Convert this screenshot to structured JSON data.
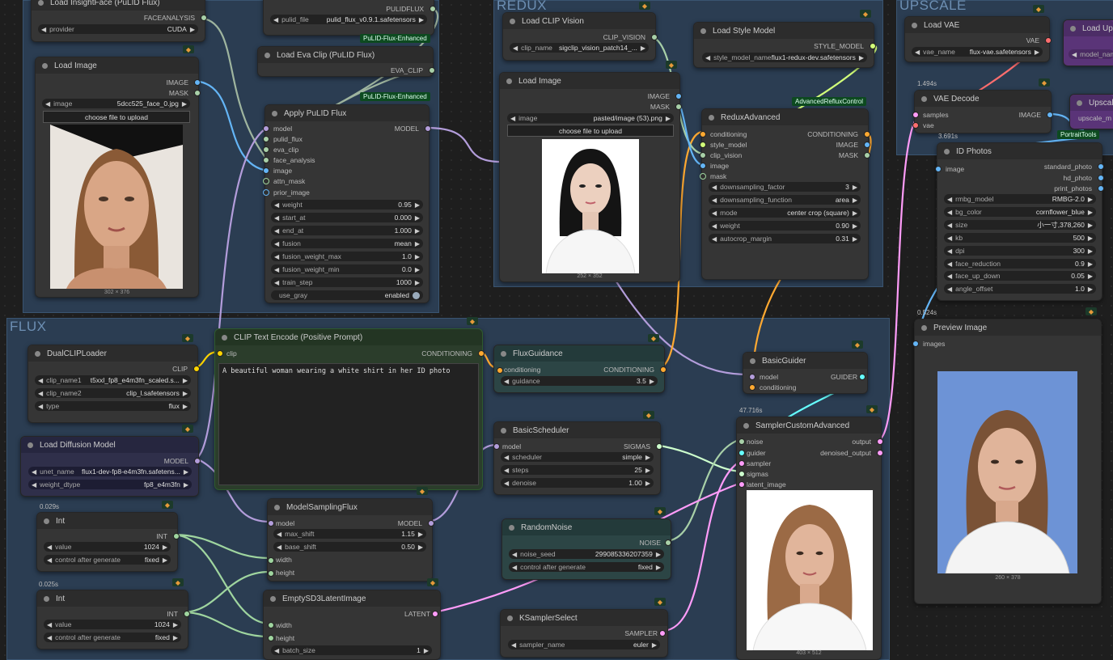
{
  "groups": {
    "flux_title": "FLUX",
    "redux_title": "REDUX",
    "upscale_title": "UPSCALE"
  },
  "nodes": {
    "insightface": {
      "title": "Load InsightFace (PuLID Flux)",
      "out": "FACEANALYSIS",
      "provider_label": "provider",
      "provider_value": "CUDA"
    },
    "pulidmodel": {
      "out": "PULIDFLUX",
      "file_label": "pulid_file",
      "file_value": "pulid_flux_v0.9.1.safetensors",
      "tag": "PuLID-Flux-Enhanced"
    },
    "evaclip": {
      "title": "Load Eva Clip (PuLID Flux)",
      "out": "EVA_CLIP",
      "tag": "PuLID-Flux-Enhanced"
    },
    "loadimage1": {
      "title": "Load Image",
      "out_image": "IMAGE",
      "out_mask": "MASK",
      "image_label": "image",
      "image_value": "5dcc525_face_0.jpg",
      "upload": "choose file to upload",
      "dims": "302 × 376"
    },
    "applypulid": {
      "title": "Apply PuLID Flux",
      "out": "MODEL",
      "inputs": [
        "model",
        "pulid_flux",
        "eva_clip",
        "face_analysis",
        "image",
        "attn_mask",
        "prior_image"
      ],
      "widgets": [
        {
          "label": "weight",
          "value": "0.95"
        },
        {
          "label": "start_at",
          "value": "0.000"
        },
        {
          "label": "end_at",
          "value": "1.000"
        },
        {
          "label": "fusion",
          "value": "mean"
        },
        {
          "label": "fusion_weight_max",
          "value": "1.0"
        },
        {
          "label": "fusion_weight_min",
          "value": "0.0"
        },
        {
          "label": "train_step",
          "value": "1000"
        }
      ],
      "use_gray_label": "use_gray",
      "use_gray_value": "enabled"
    },
    "clipvision": {
      "title": "Load CLIP Vision",
      "out": "CLIP_VISION",
      "name_label": "clip_name",
      "name_value": "sigclip_vision_patch14_..."
    },
    "stylemodel": {
      "title": "Load Style Model",
      "out": "STYLE_MODEL",
      "name_label": "style_model_name",
      "name_value": "flux1-redux-dev.safetensors"
    },
    "loadimage2": {
      "title": "Load Image",
      "out_image": "IMAGE",
      "out_mask": "MASK",
      "image_label": "image",
      "image_value": "pasted/image (53).png",
      "upload": "choose file to upload",
      "dims": "252 × 352"
    },
    "reduxadvanced": {
      "title": "ReduxAdvanced",
      "tag": "AdvancedRefluxControl",
      "inputs": [
        "conditioning",
        "style_model",
        "clip_vision",
        "image",
        "mask"
      ],
      "outputs": [
        "CONDITIONING",
        "IMAGE",
        "MASK"
      ],
      "widgets": [
        {
          "label": "downsampling_factor",
          "value": "3"
        },
        {
          "label": "downsampling_function",
          "value": "area"
        },
        {
          "label": "mode",
          "value": "center crop (square)"
        },
        {
          "label": "weight",
          "value": "0.90"
        },
        {
          "label": "autocrop_margin",
          "value": "0.31"
        }
      ]
    },
    "loadvae": {
      "title": "Load VAE",
      "out": "VAE",
      "name_label": "vae_name",
      "name_value": "flux-vae.safetensors"
    },
    "loadupscale": {
      "title": "Load Upsc",
      "name_label": "model_nam"
    },
    "vaedecode": {
      "title": "VAE Decode",
      "time": "1.494s",
      "in_samples": "samples",
      "in_vae": "vae",
      "out": "IMAGE"
    },
    "upscale2": {
      "title": "Upscale",
      "in": "upscale_m"
    },
    "idphotos": {
      "title": "ID Photos",
      "time": "3.691s",
      "tag": "PortraitTools",
      "in": "image",
      "outputs": [
        "standard_photo",
        "hd_photo",
        "print_photos"
      ],
      "widgets": [
        {
          "label": "rmbg_model",
          "value": "RMBG-2.0"
        },
        {
          "label": "bg_color",
          "value": "cornflower_blue"
        },
        {
          "label": "size",
          "value": "小一寸,378,260"
        },
        {
          "label": "kb",
          "value": "500"
        },
        {
          "label": "dpi",
          "value": "300"
        },
        {
          "label": "face_reduction",
          "value": "0.9"
        },
        {
          "label": "face_up_down",
          "value": "0.05"
        },
        {
          "label": "angle_offset",
          "value": "1.0"
        }
      ]
    },
    "preview": {
      "title": "Preview Image",
      "time": "0.524s",
      "in": "images",
      "dims": "260 × 378"
    },
    "dualclip": {
      "title": "DualCLIPLoader",
      "out": "CLIP",
      "widgets": [
        {
          "label": "clip_name1",
          "value": "t5xxl_fp8_e4m3fn_scaled.s..."
        },
        {
          "label": "clip_name2",
          "value": "clip_l.safetensors"
        },
        {
          "label": "type",
          "value": "flux"
        }
      ]
    },
    "cliptext": {
      "title": "CLIP Text Encode (Positive Prompt)",
      "in": "clip",
      "out": "CONDITIONING",
      "text": "A beautiful woman wearing a white shirt in her ID photo"
    },
    "fluxguidance": {
      "title": "FluxGuidance",
      "in": "conditioning",
      "out": "CONDITIONING",
      "guid_label": "guidance",
      "guid_value": "3.5"
    },
    "basicguider": {
      "title": "BasicGuider",
      "in_model": "model",
      "in_cond": "conditioning",
      "out": "GUIDER"
    },
    "loaddiff": {
      "title": "Load Diffusion Model",
      "out": "MODEL",
      "widgets": [
        {
          "label": "unet_name",
          "value": "flux1-dev-fp8-e4m3fn.safetens..."
        },
        {
          "label": "weight_dtype",
          "value": "fp8_e4m3fn"
        }
      ]
    },
    "basicscheduler": {
      "title": "BasicScheduler",
      "in": "model",
      "out": "SIGMAS",
      "widgets": [
        {
          "label": "scheduler",
          "value": "simple"
        },
        {
          "label": "steps",
          "value": "25"
        },
        {
          "label": "denoise",
          "value": "1.00"
        }
      ]
    },
    "sampler": {
      "title": "SamplerCustomAdvanced",
      "time": "47.716s",
      "inputs": [
        "noise",
        "guider",
        "sampler",
        "sigmas",
        "latent_image"
      ],
      "outputs": [
        "output",
        "denoised_output"
      ],
      "dims": "403 × 512"
    },
    "int1": {
      "title": "Int",
      "time": "0.029s",
      "out": "INT",
      "widgets": [
        {
          "label": "value",
          "value": "1024"
        },
        {
          "label": "control after generate",
          "value": "fixed"
        }
      ]
    },
    "int2": {
      "title": "Int",
      "time": "0.025s",
      "out": "INT",
      "widgets": [
        {
          "label": "value",
          "value": "1024"
        },
        {
          "label": "control after generate",
          "value": "fixed"
        }
      ]
    },
    "msf": {
      "title": "ModelSamplingFlux",
      "out": "MODEL",
      "inputs": [
        "model",
        "width",
        "height"
      ],
      "widgets": [
        {
          "label": "max_shift",
          "value": "1.15"
        },
        {
          "label": "base_shift",
          "value": "0.50"
        }
      ]
    },
    "randomnoise": {
      "title": "RandomNoise",
      "out": "NOISE",
      "widgets": [
        {
          "label": "noise_seed",
          "value": "299085336207359"
        },
        {
          "label": "control after generate",
          "value": "fixed"
        }
      ]
    },
    "emptylatent": {
      "title": "EmptySD3LatentImage",
      "out": "LATENT",
      "inputs": [
        "width",
        "height"
      ],
      "widgets": [
        {
          "label": "batch_size",
          "value": "1"
        }
      ]
    },
    "ksamplerselect": {
      "title": "KSamplerSelect",
      "out": "SAMPLER",
      "widgets": [
        {
          "label": "sampler_name",
          "value": "euler"
        }
      ]
    }
  },
  "colors": {
    "image": "#64b5f6",
    "model": "#b39ddb",
    "clip": "#ffd500",
    "conditioning": "#ffa931",
    "latent": "#ff9cf9",
    "int": "#9fd59f",
    "vae": "#ff6e6e",
    "sigmas": "#cdffcd",
    "guider": "#66ffff",
    "generic": "#a8d0a8"
  }
}
